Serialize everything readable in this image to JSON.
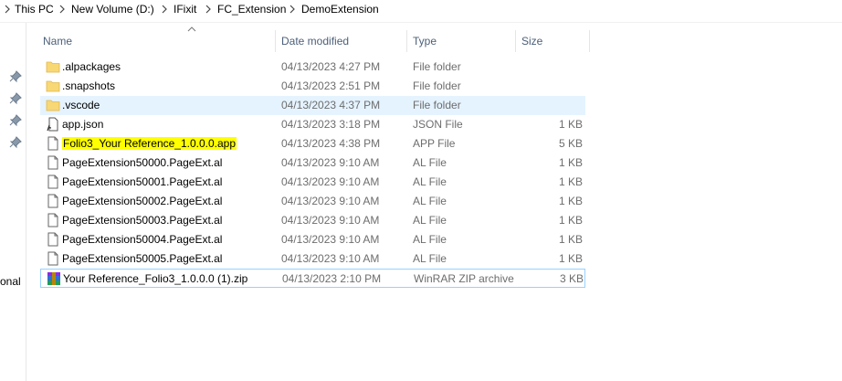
{
  "breadcrumb": [
    "This PC",
    "New Volume (D:)",
    "IFixit",
    "FC_Extension",
    "DemoExtension"
  ],
  "nav": {
    "cut_label": "onal"
  },
  "columns": {
    "name": "Name",
    "date": "Date modified",
    "type": "Type",
    "size": "Size"
  },
  "rows": [
    {
      "icon": "folder-icon",
      "name": ".alpackages",
      "date": "04/13/2023 4:27 PM",
      "type": "File folder",
      "size": ""
    },
    {
      "icon": "folder-icon",
      "name": ".snapshots",
      "date": "04/13/2023 2:51 PM",
      "type": "File folder",
      "size": ""
    },
    {
      "icon": "folder-icon",
      "name": ".vscode",
      "date": "04/13/2023 4:37 PM",
      "type": "File folder",
      "size": ""
    },
    {
      "icon": "json-file-icon",
      "name": "app.json",
      "date": "04/13/2023 3:18 PM",
      "type": "JSON File",
      "size": "1 KB"
    },
    {
      "icon": "file-icon",
      "name": "Folio3_Your Reference_1.0.0.0.app",
      "date": "04/13/2023 4:38 PM",
      "type": "APP File",
      "size": "5 KB",
      "highlight": "#ffff00"
    },
    {
      "icon": "file-icon",
      "name": "PageExtension50000.PageExt.al",
      "date": "04/13/2023 9:10 AM",
      "type": "AL File",
      "size": "1 KB"
    },
    {
      "icon": "file-icon",
      "name": "PageExtension50001.PageExt.al",
      "date": "04/13/2023 9:10 AM",
      "type": "AL File",
      "size": "1 KB"
    },
    {
      "icon": "file-icon",
      "name": "PageExtension50002.PageExt.al",
      "date": "04/13/2023 9:10 AM",
      "type": "AL File",
      "size": "1 KB"
    },
    {
      "icon": "file-icon",
      "name": "PageExtension50003.PageExt.al",
      "date": "04/13/2023 9:10 AM",
      "type": "AL File",
      "size": "1 KB"
    },
    {
      "icon": "file-icon",
      "name": "PageExtension50004.PageExt.al",
      "date": "04/13/2023 9:10 AM",
      "type": "AL File",
      "size": "1 KB"
    },
    {
      "icon": "file-icon",
      "name": "PageExtension50005.PageExt.al",
      "date": "04/13/2023 9:10 AM",
      "type": "AL File",
      "size": "1 KB"
    },
    {
      "icon": "winrar-archive-icon",
      "name": "Your Reference_Folio3_1.0.0.0 (1).zip",
      "date": "04/13/2023 2:10 PM",
      "type": "WinRAR ZIP archive",
      "size": "3 KB"
    }
  ],
  "colors": {
    "header_text": "#4c607a",
    "selection": "#e5f3ff",
    "focus_border": "#99d1ff",
    "highlight": "#ffff00",
    "folder": "#f8d775"
  }
}
